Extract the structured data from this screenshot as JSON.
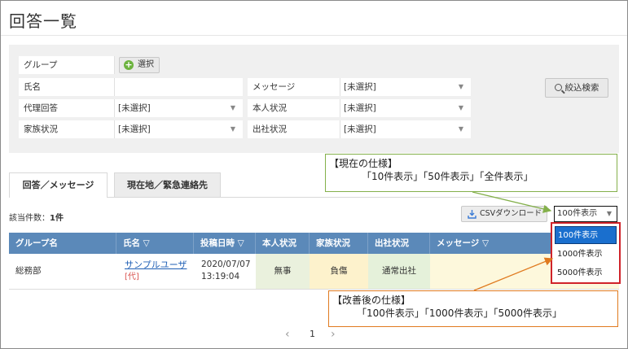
{
  "page": {
    "title": "回答一覧"
  },
  "filters": {
    "group_label": "グループ",
    "select_button": "選択",
    "name_label": "氏名",
    "name_value": "",
    "message_label": "メッセージ",
    "message_value": "[未選択]",
    "proxy_label": "代理回答",
    "proxy_value": "[未選択]",
    "self_status_label": "本人状況",
    "self_status_value": "[未選択]",
    "family_label": "家族状況",
    "family_value": "[未選択]",
    "office_label": "出社状況",
    "office_value": "[未選択]",
    "search_button": "絞込検索"
  },
  "tabs": [
    {
      "label": "回答／メッセージ",
      "active": true
    },
    {
      "label": "現在地／緊急連絡先",
      "active": false
    }
  ],
  "results": {
    "count_label": "該当件数：",
    "count_value": "1件",
    "csv_button": "CSVダウンロード",
    "per_page_selected": "100件表示",
    "per_page_options": [
      "100件表示",
      "1000件表示",
      "5000件表示"
    ]
  },
  "table": {
    "headers": [
      "グループ名",
      "氏名 ▽",
      "投稿日時 ▽",
      "本人状況",
      "家族状況",
      "出社状況",
      "メッセージ ▽"
    ],
    "rows": [
      {
        "group": "総務部",
        "name": "サンプルユーザ",
        "proxy_tag": "[代]",
        "date": "2020/07/07",
        "time": "13:19:04",
        "self_status": "無事",
        "family_status": "負傷",
        "office_status": "通常出社",
        "message": ""
      }
    ]
  },
  "pagination": {
    "current": "1"
  },
  "annotations": {
    "current_title": "【現在の仕様】",
    "current_body": "「10件表示」「50件表示」「全件表示」",
    "improved_title": "【改善後の仕様】",
    "improved_body": "「100件表示」「1000件表示」「5000件表示」"
  },
  "colors": {
    "table_header": "#5b89b9",
    "self_status_bg": "#eaf1dd",
    "family_status_bg": "#fdf2cc",
    "office_status_bg": "#e5f1da",
    "message_bg": "#fdf8dc",
    "dropdown_border": "#d0232a",
    "selected_option": "#1a6fce",
    "current_callout": "#84b04b",
    "improved_callout": "#e07a1f",
    "link_name": "#1f5fb5",
    "proxy_tag": "#d9534f"
  },
  "icons": {
    "add": "plus-circle-icon",
    "search": "magnifier-icon",
    "download": "download-icon",
    "caret": "caret-down-icon"
  }
}
